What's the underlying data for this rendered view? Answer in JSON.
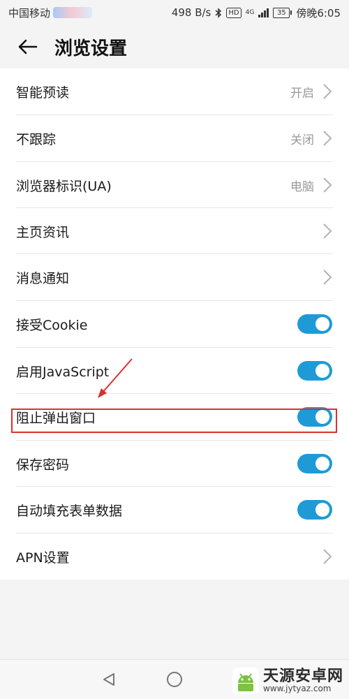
{
  "status_bar": {
    "carrier": "中国移动",
    "net_speed": "498 B/s",
    "hd_badge": "HD",
    "network_type": "4G",
    "battery": "35",
    "time": "傍晚6:05"
  },
  "header": {
    "title": "浏览设置"
  },
  "settings": [
    {
      "label": "智能预读",
      "value": "开启",
      "type": "link"
    },
    {
      "label": "不跟踪",
      "value": "关闭",
      "type": "link"
    },
    {
      "label": "浏览器标识(UA)",
      "value": "电脑",
      "type": "link"
    },
    {
      "label": "主页资讯",
      "value": "",
      "type": "link"
    },
    {
      "label": "消息通知",
      "value": "",
      "type": "link"
    },
    {
      "label": "接受Cookie",
      "type": "toggle",
      "on": true
    },
    {
      "label": "启用JavaScript",
      "type": "toggle",
      "on": true
    },
    {
      "label": "阻止弹出窗口",
      "type": "toggle",
      "on": true
    },
    {
      "label": "保存密码",
      "type": "toggle",
      "on": true
    },
    {
      "label": "自动填充表单数据",
      "type": "toggle",
      "on": true
    },
    {
      "label": "APN设置",
      "value": "",
      "type": "link"
    }
  ],
  "colors": {
    "toggle_on": "#1e9bd7",
    "annotation": "#d93030"
  },
  "watermark": {
    "name": "天源安卓网",
    "url": "www.jytyaz.com"
  }
}
